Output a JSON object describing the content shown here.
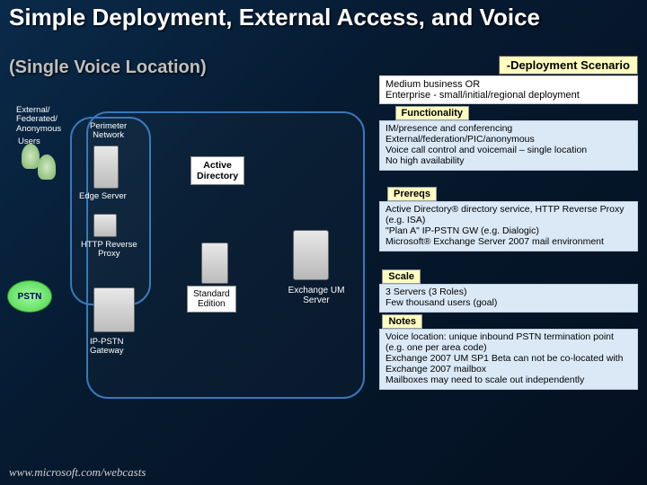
{
  "title": "Simple Deployment, External Access, and Voice",
  "subtitle": "(Single Voice Location)",
  "deployment_scenario_label": "-Deployment Scenario",
  "scenario_text": "Medium business OR\nEnterprise - small/initial/regional deployment",
  "functionality": {
    "label": "Functionality",
    "text": "IM/presence and conferencing\nExternal/federation/PIC/anonymous\nVoice call control and voicemail – single location\nNo high availability"
  },
  "prereqs": {
    "label": "Prereqs",
    "text": "Active Directory® directory service, HTTP Reverse Proxy (e.g. ISA)\n\"Plan A\" IP-PSTN GW (e.g. Dialogic)\nMicrosoft® Exchange Server 2007 mail environment"
  },
  "scale": {
    "label": "Scale",
    "text": "3 Servers (3 Roles)\nFew thousand users (goal)"
  },
  "notes": {
    "label": "Notes",
    "text": "Voice location: unique inbound PSTN termination point (e.g. one per area code)\nExchange 2007 UM SP1 Beta can not be co-located with Exchange 2007 mailbox\nMailboxes may need to scale out independently"
  },
  "diagram": {
    "external_users": "External/\nFederated/\nAnonymous",
    "users": "Users",
    "perimeter_network": "Perimeter\nNetwork",
    "edge_server": "Edge Server",
    "http_reverse_proxy": "HTTP Reverse\nProxy",
    "pstn": "PSTN",
    "ip_pstn_gateway": "IP-PSTN\nGateway",
    "standard_edition": "Standard\nEdition",
    "active_directory": "Active\nDirectory",
    "exchange_um_server": "Exchange UM\nServer"
  },
  "footer": "www.microsoft.com/webcasts"
}
